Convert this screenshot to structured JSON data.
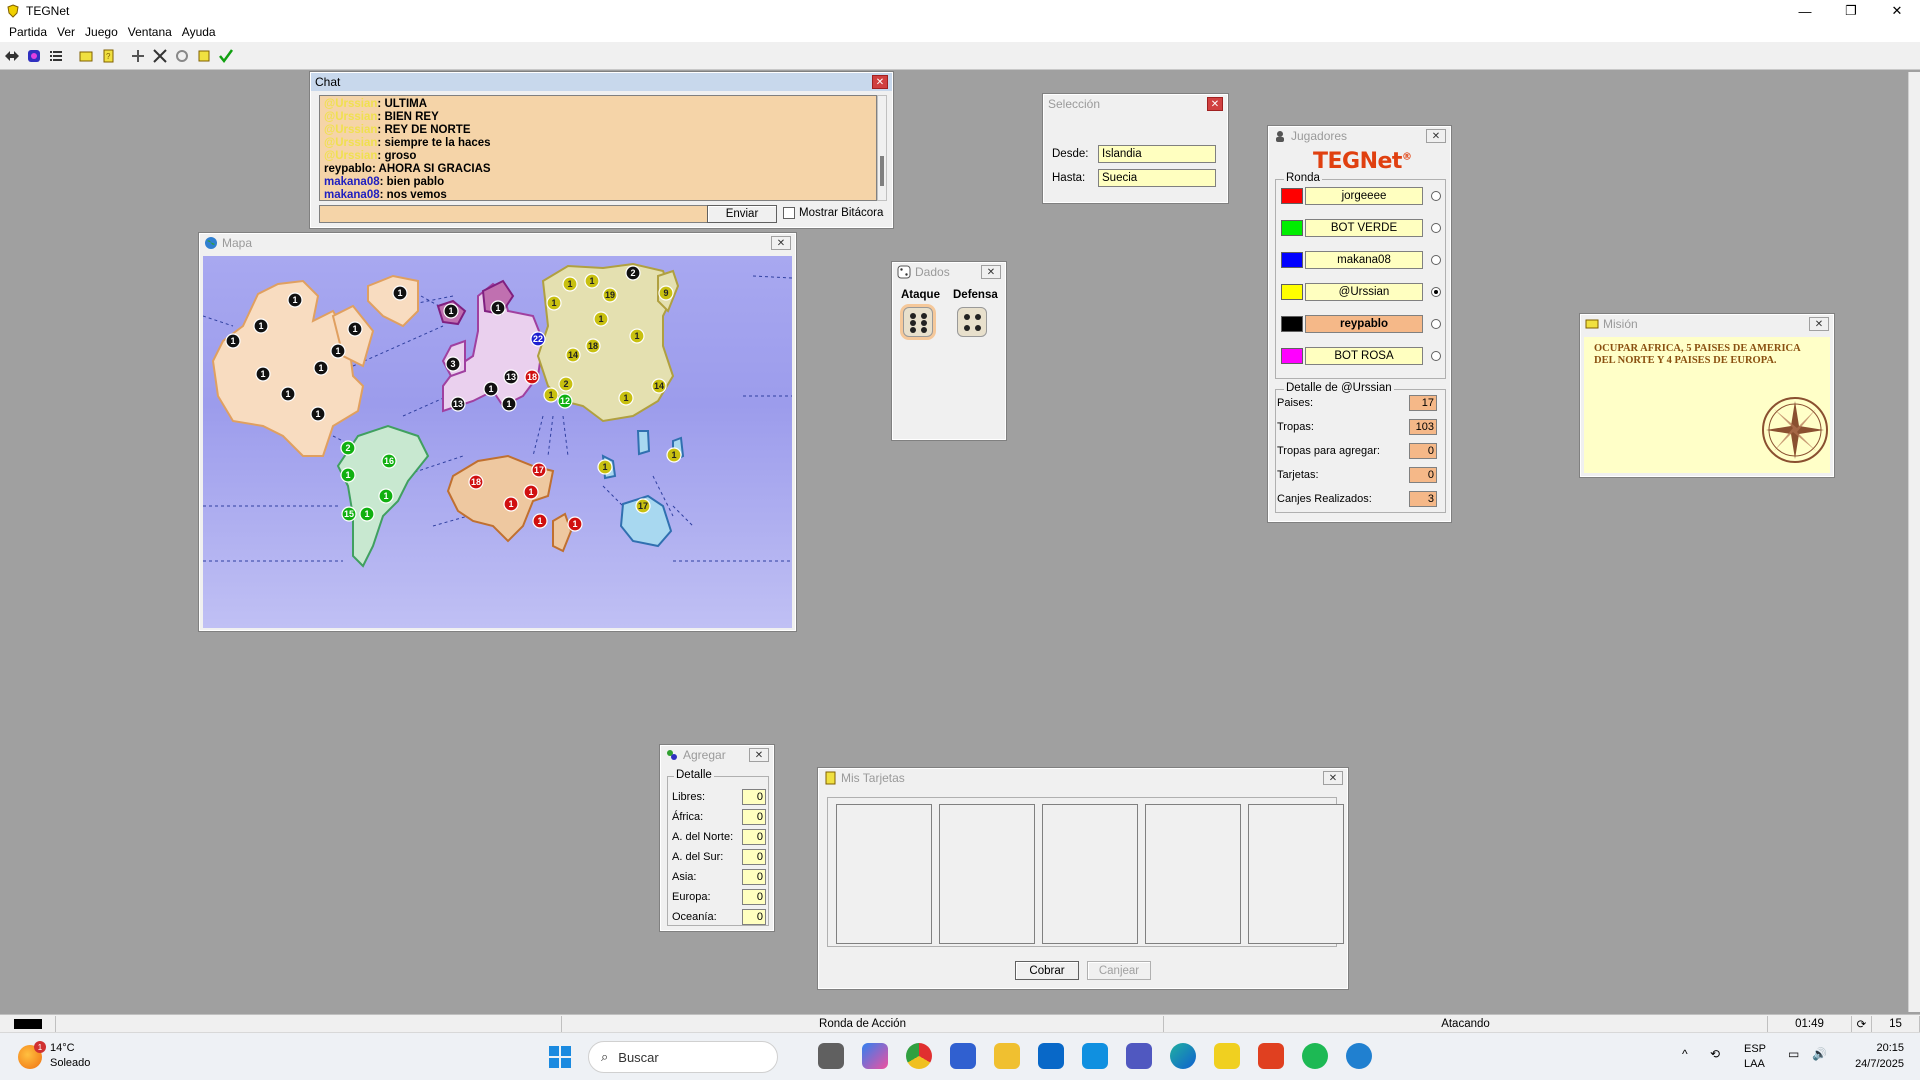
{
  "window": {
    "title": "TEGNet",
    "controls": {
      "minimize": "—",
      "maximize": "❐",
      "close": "✕"
    }
  },
  "menu": [
    "Partida",
    "Ver",
    "Juego",
    "Ventana",
    "Ayuda"
  ],
  "chat": {
    "title": "Chat",
    "messages": [
      {
        "user": "@Urssian",
        "text": "ULTIMA",
        "color": "#f0e050"
      },
      {
        "user": "@Urssian",
        "text": "BIEN REY",
        "color": "#f0e050"
      },
      {
        "user": "@Urssian",
        "text": "REY DE NORTE",
        "color": "#f0e050"
      },
      {
        "user": "@Urssian",
        "text": "siempre te la haces",
        "color": "#f0e050"
      },
      {
        "user": "@Urssian",
        "text": "groso",
        "color": "#f0e050"
      },
      {
        "user": "reypablo",
        "text": "AHORA SI GRACIAS",
        "color": "#000000"
      },
      {
        "user": "makana08",
        "text": "bien pablo",
        "color": "#2020c0"
      },
      {
        "user": "makana08",
        "text": "nos vemos",
        "color": "#2020c0"
      }
    ],
    "send_label": "Enviar",
    "log_label": "Mostrar Bitácora"
  },
  "mapa": {
    "title": "Mapa",
    "armies": [
      {
        "n": "1",
        "c": "#111"
      },
      {
        "n": "1",
        "c": "#111"
      },
      {
        "n": "1",
        "c": "#111"
      },
      {
        "n": "1",
        "c": "#111"
      },
      {
        "n": "1",
        "c": "#111"
      },
      {
        "n": "1",
        "c": "#111"
      },
      {
        "n": "1",
        "c": "#111"
      },
      {
        "n": "1",
        "c": "#111"
      },
      {
        "n": "1",
        "c": "#111"
      },
      {
        "n": "1",
        "c": "#111"
      },
      {
        "n": "1",
        "c": "#111"
      },
      {
        "n": "1",
        "c": "#111"
      },
      {
        "n": "3",
        "c": "#111"
      },
      {
        "n": "13",
        "c": "#111"
      },
      {
        "n": "1",
        "c": "#111"
      },
      {
        "n": "13",
        "c": "#111"
      },
      {
        "n": "1",
        "c": "#111"
      },
      {
        "n": "22",
        "c": "#2020d0"
      },
      {
        "n": "2",
        "c": "#111"
      },
      {
        "n": "1",
        "c": "#c8c010"
      },
      {
        "n": "1",
        "c": "#c8c010"
      },
      {
        "n": "19",
        "c": "#c8c010"
      },
      {
        "n": "1",
        "c": "#c8c010"
      },
      {
        "n": "1",
        "c": "#c8c010"
      },
      {
        "n": "18",
        "c": "#c8c010"
      },
      {
        "n": "1",
        "c": "#c8c010"
      },
      {
        "n": "14",
        "c": "#c8c010"
      },
      {
        "n": "9",
        "c": "#c8c010"
      },
      {
        "n": "2",
        "c": "#c8c010"
      },
      {
        "n": "1",
        "c": "#c8c010"
      },
      {
        "n": "14",
        "c": "#c8c010"
      },
      {
        "n": "18",
        "c": "#d01010"
      },
      {
        "n": "12",
        "c": "#10b010"
      },
      {
        "n": "1",
        "c": "#c8c010"
      },
      {
        "n": "1",
        "c": "#c8c010"
      },
      {
        "n": "1",
        "c": "#c8c010"
      },
      {
        "n": "17",
        "c": "#c8c010"
      },
      {
        "n": "2",
        "c": "#10b010"
      },
      {
        "n": "16",
        "c": "#10b010"
      },
      {
        "n": "1",
        "c": "#10b010"
      },
      {
        "n": "1",
        "c": "#10b010"
      },
      {
        "n": "15",
        "c": "#10b010"
      },
      {
        "n": "1",
        "c": "#10b010"
      },
      {
        "n": "17",
        "c": "#d01010"
      },
      {
        "n": "18",
        "c": "#d01010"
      },
      {
        "n": "1",
        "c": "#d01010"
      },
      {
        "n": "1",
        "c": "#d01010"
      },
      {
        "n": "1",
        "c": "#d01010"
      },
      {
        "n": "1",
        "c": "#d01010"
      }
    ]
  },
  "seleccion": {
    "title": "Selección",
    "desde_label": "Desde:",
    "desde": "Islandia",
    "hasta_label": "Hasta:",
    "hasta": "Suecia"
  },
  "dados": {
    "title": "Dados",
    "ataque": "Ataque",
    "defensa": "Defensa",
    "ataque_value": 6,
    "defensa_value": 4
  },
  "jugadores": {
    "title": "Jugadores",
    "brand": "TEGNet",
    "brand_mark": "®",
    "ronda_label": "Ronda",
    "players": [
      {
        "name": "jorgeeee",
        "color": "#ff0000",
        "selected": false,
        "active": false
      },
      {
        "name": "BOT VERDE",
        "color": "#00ee00",
        "selected": false,
        "active": false
      },
      {
        "name": "makana08",
        "color": "#0000ff",
        "selected": false,
        "active": false
      },
      {
        "name": "@Urssian",
        "color": "#ffff00",
        "selected": true,
        "active": false
      },
      {
        "name": "reypablo",
        "color": "#000000",
        "selected": false,
        "active": true
      },
      {
        "name": "BOT ROSA",
        "color": "#ff00ff",
        "selected": false,
        "active": false
      }
    ],
    "detalle_label": "Detalle de @Urssian",
    "detalle": [
      {
        "label": "Paises:",
        "value": "17"
      },
      {
        "label": "Tropas:",
        "value": "103"
      },
      {
        "label": "Tropas para agregar:",
        "value": "0"
      },
      {
        "label": "Tarjetas:",
        "value": "0"
      },
      {
        "label": "Canjes Realizados:",
        "value": "3"
      }
    ]
  },
  "mision": {
    "title": "Misión",
    "text": "OCUPAR AFRICA, 5 PAISES DE AMERICA DEL NORTE Y 4 PAISES DE EUROPA."
  },
  "agregar": {
    "title": "Agregar",
    "detalle_label": "Detalle",
    "rows": [
      {
        "label": "Libres:",
        "value": "0"
      },
      {
        "label": "África:",
        "value": "0"
      },
      {
        "label": "A. del Norte:",
        "value": "0"
      },
      {
        "label": "A. del Sur:",
        "value": "0"
      },
      {
        "label": "Asia:",
        "value": "0"
      },
      {
        "label": "Europa:",
        "value": "0"
      },
      {
        "label": "Oceanía:",
        "value": "0"
      }
    ]
  },
  "tarjetas": {
    "title": "Mis Tarjetas",
    "cobrar": "Cobrar",
    "canjear": "Canjear"
  },
  "status": {
    "ronda": "Ronda de Acción",
    "estado": "Atacando",
    "timer": "01:49",
    "count": "15"
  },
  "taskbar": {
    "weather_temp": "14°C",
    "weather_desc": "Soleado",
    "weather_badge": "1",
    "search": "Buscar",
    "lang1": "ESP",
    "lang2": "LAA",
    "time": "20:15",
    "date": "24/7/2025"
  }
}
